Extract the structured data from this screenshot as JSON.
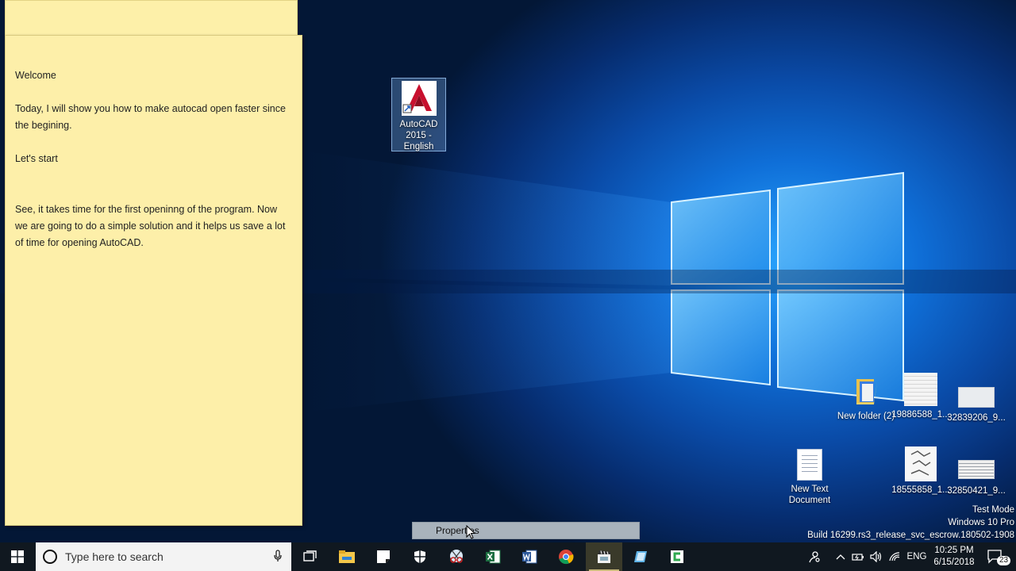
{
  "sticky_note": {
    "lines": [
      "Welcome",
      "Today, I will show you how to make autocad open faster since the begining.",
      "Let's start",
      "See, it takes time for the first openinng of the program. Now we are going to do a simple solution and it helps us save a lot of time for opening AutoCAD."
    ]
  },
  "desktop_icons": {
    "autocad": "AutoCAD 2015 - English",
    "new_folder": "New folder (2)",
    "file1": "19886588_1...",
    "file2": "32839206_9...",
    "new_text_doc": "New Text Document",
    "file3": "18555858_1...",
    "file4": "32850421_9..."
  },
  "watermark": {
    "line1": "Test Mode",
    "line2": "Windows 10 Pro",
    "line3": "Build 16299.rs3_release_svc_escrow.180502-1908"
  },
  "properties_label": "Properties",
  "taskbar": {
    "search_placeholder": "Type here to search",
    "language": "ENG",
    "time": "10:25 PM",
    "date": "6/15/2018",
    "notification_count": "23"
  }
}
